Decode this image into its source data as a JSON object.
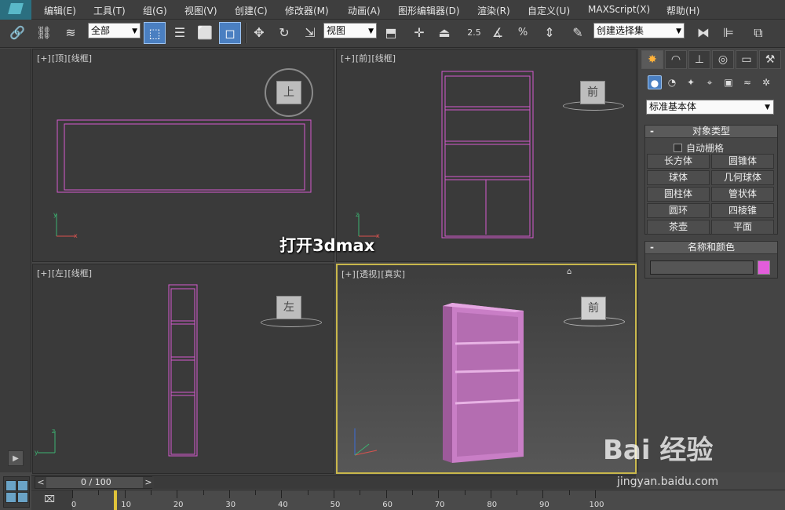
{
  "menu": {
    "items": [
      "编辑(E)",
      "工具(T)",
      "组(G)",
      "视图(V)",
      "创建(C)",
      "修改器(M)",
      "动画(A)",
      "图形编辑器(D)",
      "渲染(R)",
      "自定义(U)",
      "MAXScript(X)",
      "帮助(H)"
    ]
  },
  "toolbar": {
    "filter_select": "全部",
    "ref_coord_select": "视图",
    "snap_value": "2.5",
    "named_selection": "创建选择集"
  },
  "viewports": {
    "top": {
      "labels": [
        "[+]",
        "[顶]",
        "[线框]"
      ],
      "cube_label": "上"
    },
    "front": {
      "labels": [
        "[+]",
        "[前]",
        "[线框]"
      ],
      "cube_label": "前"
    },
    "left": {
      "labels": [
        "[+]",
        "[左]",
        "[线框]"
      ],
      "cube_label": "左"
    },
    "perspective": {
      "labels": [
        "[+]",
        "[透视]",
        "[真实]"
      ],
      "cube_label": "前"
    }
  },
  "command_panel": {
    "primitive_select": "标准基本体",
    "object_type_title": "对象类型",
    "auto_grid_label": "自动栅格",
    "buttons": [
      "长方体",
      "圆锥体",
      "球体",
      "几何球体",
      "圆柱体",
      "管状体",
      "圆环",
      "四棱锥",
      "茶壶",
      "平面"
    ],
    "name_color_title": "名称和颜色",
    "object_color": "#e25ddb"
  },
  "timeline": {
    "position_text": "0 / 100",
    "ticks": [
      "0",
      "10",
      "20",
      "30",
      "40",
      "50",
      "60",
      "70",
      "80",
      "90",
      "100"
    ]
  },
  "caption": "打开3dmax",
  "watermark": {
    "logo": "Bai 经验",
    "url": "jingyan.baidu.com"
  },
  "colors": {
    "wireframe": "#d65ad0",
    "object": "#c97ec6",
    "active_border": "#c9b74b"
  }
}
